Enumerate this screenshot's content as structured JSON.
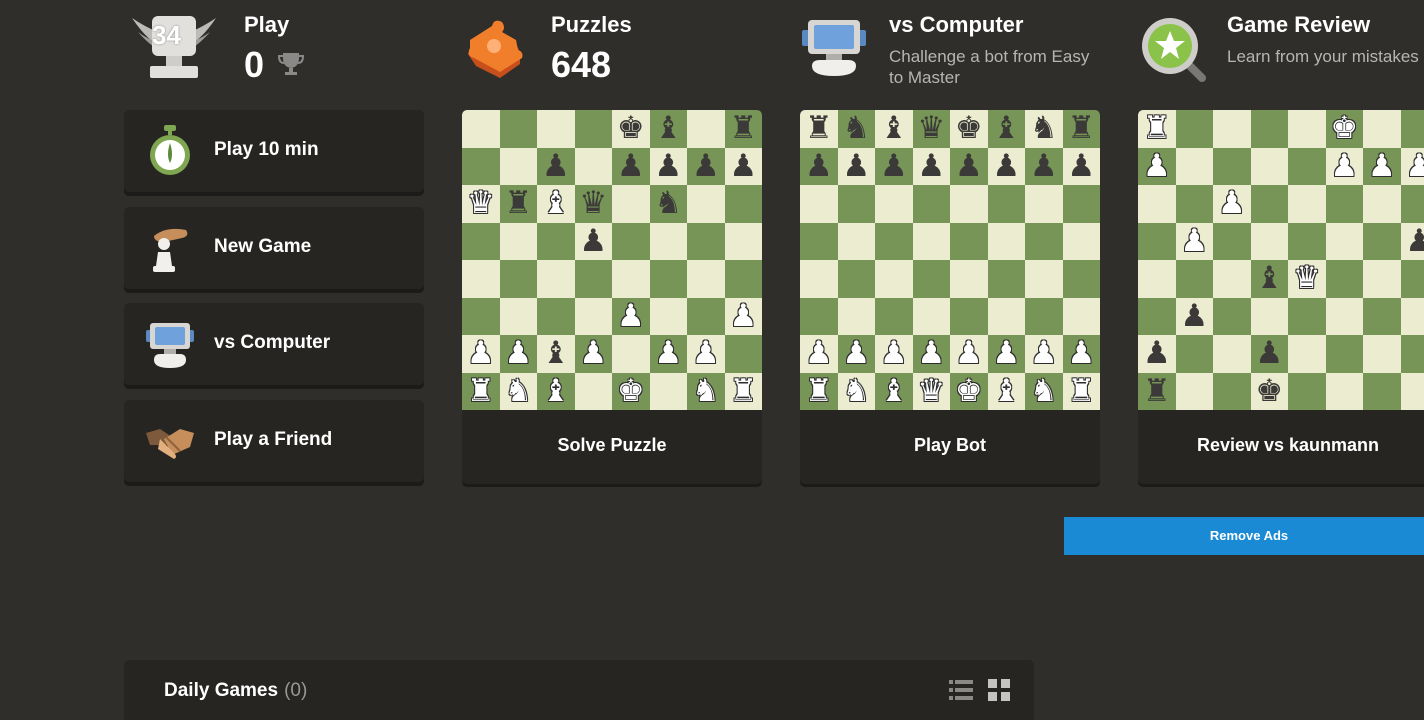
{
  "stats": {
    "play": {
      "title": "Play",
      "value": "0",
      "badge": "34"
    },
    "puzzles": {
      "title": "Puzzles",
      "value": "648"
    },
    "computer": {
      "title": "vs Computer",
      "subtitle_line1": "Challenge a bot from Easy",
      "subtitle_line2": "to Master"
    },
    "review": {
      "title": "Game Review",
      "subtitle": "Learn from your mistakes"
    }
  },
  "side_buttons": [
    {
      "label": "Play 10 min",
      "icon": "stopwatch-icon"
    },
    {
      "label": "New Game",
      "icon": "hand-pawn-icon"
    },
    {
      "label": "vs Computer",
      "icon": "robot-icon"
    },
    {
      "label": "Play a Friend",
      "icon": "handshake-icon"
    }
  ],
  "cards": [
    {
      "label": "Solve Puzzle",
      "board": [
        [
          "",
          "",
          "",
          "",
          "bk",
          "bb",
          "",
          "br"
        ],
        [
          "",
          "",
          "bp",
          "",
          "bp",
          "bp",
          "bp",
          "bp"
        ],
        [
          "wq",
          "br",
          "wb",
          "bq",
          "",
          "bn",
          "",
          ""
        ],
        [
          "",
          "",
          "",
          "bp",
          "",
          "",
          "",
          ""
        ],
        [
          "",
          "",
          "",
          "",
          "",
          "",
          "",
          ""
        ],
        [
          "",
          "",
          "",
          "",
          "wp",
          "",
          "",
          "wp"
        ],
        [
          "wp",
          "wp",
          "bb",
          "wp",
          "",
          "wp",
          "wp",
          ""
        ],
        [
          "wr",
          "wn",
          "wb",
          "",
          "wk",
          "",
          "wn",
          "wr"
        ]
      ]
    },
    {
      "label": "Play Bot",
      "board": [
        [
          "br",
          "bn",
          "bb",
          "bq",
          "bk",
          "bb",
          "bn",
          "br"
        ],
        [
          "bp",
          "bp",
          "bp",
          "bp",
          "bp",
          "bp",
          "bp",
          "bp"
        ],
        [
          "",
          "",
          "",
          "",
          "",
          "",
          "",
          ""
        ],
        [
          "",
          "",
          "",
          "",
          "",
          "",
          "",
          ""
        ],
        [
          "",
          "",
          "",
          "",
          "",
          "",
          "",
          ""
        ],
        [
          "",
          "",
          "",
          "",
          "",
          "",
          "",
          ""
        ],
        [
          "wp",
          "wp",
          "wp",
          "wp",
          "wp",
          "wp",
          "wp",
          "wp"
        ],
        [
          "wr",
          "wn",
          "wb",
          "wq",
          "wk",
          "wb",
          "wn",
          "wr"
        ]
      ]
    },
    {
      "label": "Review vs kaunmann",
      "board": [
        [
          "wr",
          "",
          "",
          "",
          "",
          "wk",
          "",
          ""
        ],
        [
          "wp",
          "",
          "",
          "",
          "",
          "wp",
          "wp",
          "wp"
        ],
        [
          "",
          "",
          "wp",
          "",
          "",
          "",
          "",
          ""
        ],
        [
          "",
          "wp",
          "",
          "",
          "",
          "",
          "",
          "bp"
        ],
        [
          "",
          "",
          "",
          "bb",
          "wq",
          "",
          "",
          ""
        ],
        [
          "",
          "bp",
          "",
          "",
          "",
          "",
          "",
          ""
        ],
        [
          "bp",
          "",
          "",
          "bp",
          "",
          "",
          "",
          ""
        ],
        [
          "br",
          "",
          "",
          "bk",
          "",
          "",
          "",
          ""
        ]
      ]
    }
  ],
  "remove_ads": "Remove Ads",
  "daily": {
    "title": "Daily Games",
    "count": "(0)"
  },
  "colors": {
    "background": "#302e2b",
    "panel": "#262522",
    "light_square": "#ebecd0",
    "dark_square": "#779556",
    "accent_blue": "#1a8ad4"
  }
}
